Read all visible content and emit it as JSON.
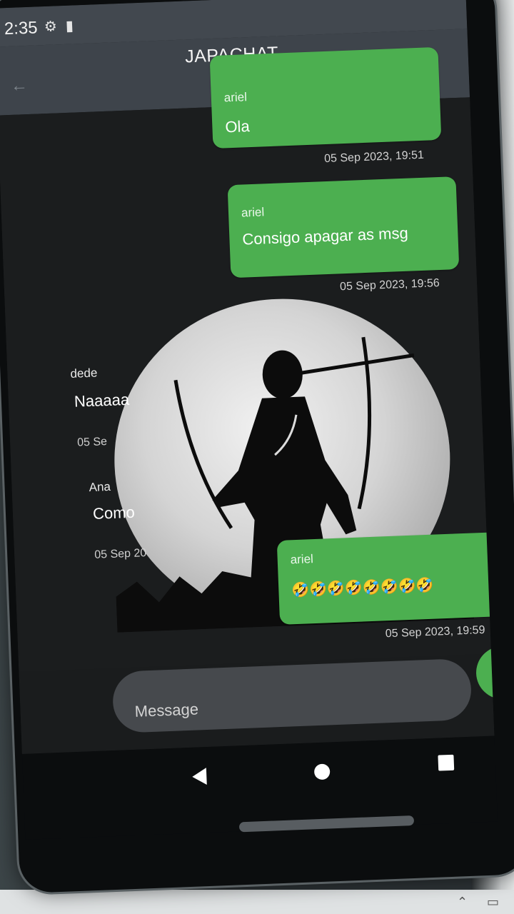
{
  "status_bar": {
    "time": "2:35",
    "icons": [
      "gear-icon",
      "sim-card-icon"
    ]
  },
  "app_bar": {
    "title": "JAPACHAT",
    "back_icon": "arrow-left-icon"
  },
  "messages": [
    {
      "direction": "outgoing",
      "sender": "ariel",
      "text": "Ola",
      "timestamp": "05 Sep 2023, 19:51"
    },
    {
      "direction": "outgoing",
      "sender": "ariel",
      "text": "Consigo apagar as msg",
      "timestamp": "05 Sep 2023, 19:56"
    },
    {
      "direction": "incoming",
      "sender": "dede",
      "text": "Naaaaa",
      "timestamp": "05 Se"
    },
    {
      "direction": "incoming",
      "sender": "Ana",
      "text": "Como",
      "timestamp": "05 Sep 20"
    },
    {
      "direction": "outgoing",
      "sender": "ariel",
      "text": "🤣🤣🤣🤣🤣🤣🤣🤣",
      "timestamp": "05 Sep 2023, 19:59"
    }
  ],
  "composer": {
    "placeholder": "Message",
    "send_icon": "send-icon"
  },
  "nav_bar": {
    "icons": [
      "back-triangle-icon",
      "home-circle-icon",
      "recents-square-icon"
    ]
  },
  "colors": {
    "bubble": "#4caf50",
    "app_bar": "#3e444b",
    "background": "#1c1e1f"
  }
}
